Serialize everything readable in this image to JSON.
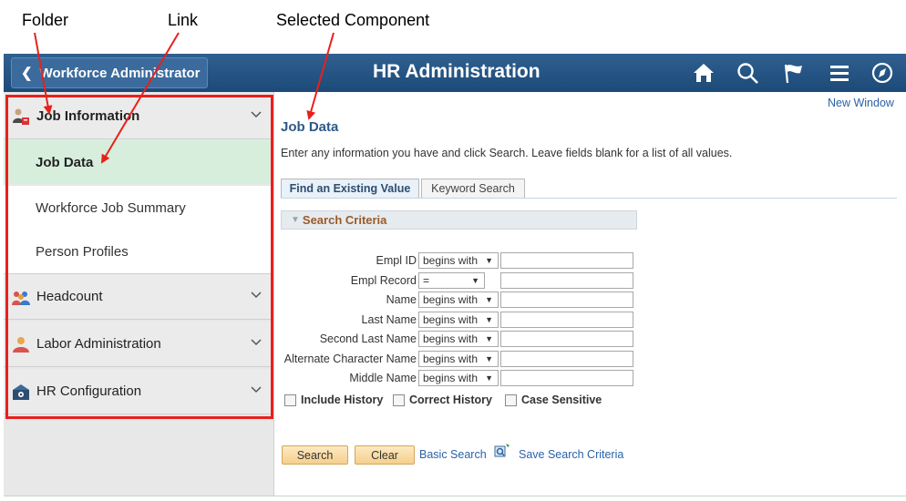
{
  "annotations": {
    "folder": "Folder",
    "link": "Link",
    "selected_component": "Selected Component"
  },
  "header": {
    "back_label": "Workforce Administrator",
    "title": "HR Administration",
    "icons": [
      "home-icon",
      "search-icon",
      "flag-icon",
      "menu-icon",
      "compass-icon"
    ],
    "bg_color": "#1f4e7d"
  },
  "sidebar": {
    "folders": [
      {
        "label": "Job Information",
        "icon": "job-information-icon"
      },
      {
        "label": "Headcount",
        "icon": "headcount-icon"
      },
      {
        "label": "Labor Administration",
        "icon": "labor-administration-icon"
      },
      {
        "label": "HR Configuration",
        "icon": "hr-configuration-icon"
      }
    ],
    "links": [
      {
        "label": "Job Data",
        "active": true
      },
      {
        "label": "Workforce Job Summary"
      },
      {
        "label": "Person Profiles"
      }
    ],
    "highlight_color": "#e8201c",
    "active_bg": "#d7eedc"
  },
  "main": {
    "new_window": "New Window",
    "page_title": "Job Data",
    "instructions": "Enter any information you have and click Search. Leave fields blank for a list of all values.",
    "tabs": [
      {
        "label": "Find an Existing Value",
        "active": true
      },
      {
        "label": "Keyword Search",
        "active": false
      }
    ],
    "criteria_title": "Search Criteria",
    "fields": [
      {
        "label": "Empl ID",
        "operator": "begins with",
        "value": ""
      },
      {
        "label": "Empl Record",
        "operator": "=",
        "value": ""
      },
      {
        "label": "Name",
        "operator": "begins with",
        "value": ""
      },
      {
        "label": "Last Name",
        "operator": "begins with",
        "value": ""
      },
      {
        "label": "Second Last Name",
        "operator": "begins with",
        "value": ""
      },
      {
        "label": "Alternate Character Name",
        "operator": "begins with",
        "value": ""
      },
      {
        "label": "Middle Name",
        "operator": "begins with",
        "value": ""
      }
    ],
    "checkboxes": [
      {
        "label": "Include History",
        "checked": false
      },
      {
        "label": "Correct History",
        "checked": false
      },
      {
        "label": "Case Sensitive",
        "checked": false
      }
    ],
    "buttons": {
      "search": "Search",
      "clear": "Clear",
      "basic_search": "Basic Search",
      "save_search": "Save Search Criteria"
    }
  }
}
